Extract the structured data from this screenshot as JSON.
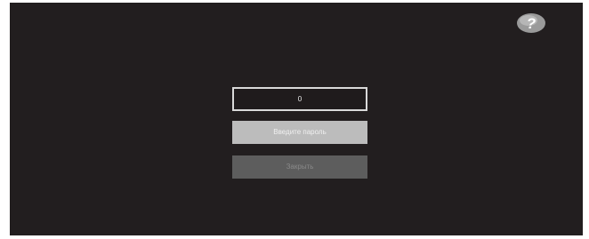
{
  "help": {
    "icon": "help-question-icon"
  },
  "pin": {
    "value": "0"
  },
  "buttons": {
    "enter_password": "Введите пароль",
    "close": "Закрыть"
  },
  "colors": {
    "screen_bg": "#221e1f",
    "field_border": "#d9d9d9",
    "button_active": "#bcbcbc",
    "button_inactive": "#5d5d5d"
  }
}
